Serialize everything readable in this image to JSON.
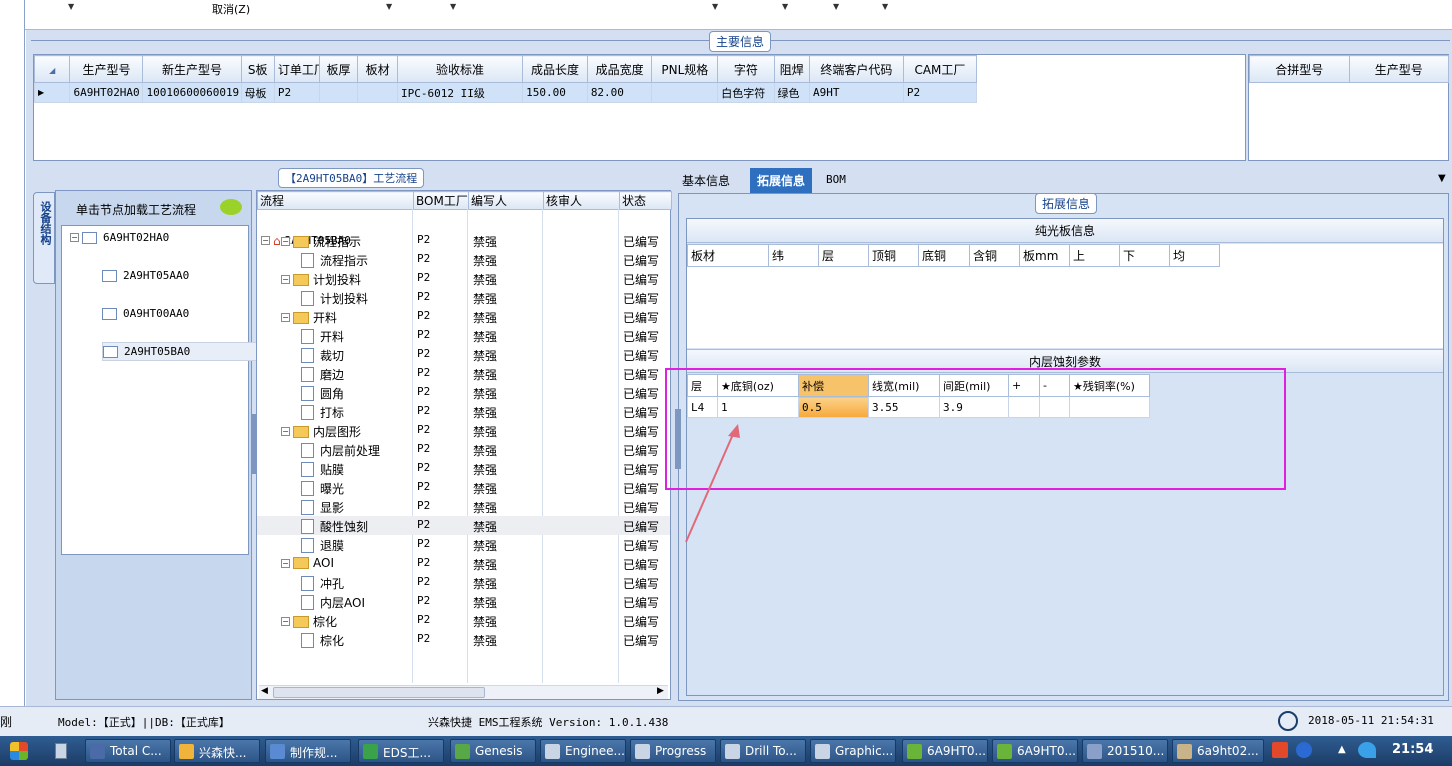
{
  "toolbar": {
    "cancel_label": "取消(Z)"
  },
  "main_info": {
    "title": "主要信息",
    "columns": [
      "生产型号",
      "新生产型号",
      "S板",
      "订单工厂",
      "板厚",
      "板材",
      "验收标准",
      "成品长度",
      "成品宽度",
      "PNL规格",
      "字符",
      "阻焊",
      "终端客户代码",
      "CAM工厂"
    ],
    "row": [
      "6A9HT02HA0",
      "10010600060019",
      "母板",
      "P2",
      "",
      "",
      "IPC-6012 II级",
      "150.00",
      "82.00",
      "",
      "白色字符",
      "绿色",
      "A9HT",
      "P2"
    ],
    "side_columns": [
      "合拼型号",
      "生产型号"
    ]
  },
  "left_panel": {
    "side_tab": "设备结构",
    "hint": "单击节点加载工艺流程",
    "tree_root": "6A9HT02HA0",
    "tree_children": [
      "2A9HT05AA0",
      "0A9HT00AA0",
      "2A9HT05BA0"
    ]
  },
  "process": {
    "title": "【2A9HT05BA0】工艺流程",
    "columns": [
      "流程",
      "BOM工厂",
      "编写人",
      "核审人",
      "状态"
    ],
    "root": "2A9HT05BA0",
    "rows": [
      {
        "name": "流程指示",
        "level": 1,
        "folder": true,
        "factory": "P2",
        "writer": "禁强",
        "reviewer": "",
        "status": "已编写"
      },
      {
        "name": "流程指示",
        "level": 2,
        "folder": false,
        "factory": "P2",
        "writer": "禁强",
        "reviewer": "",
        "status": "已编写"
      },
      {
        "name": "计划投料",
        "level": 1,
        "folder": true,
        "factory": "P2",
        "writer": "禁强",
        "reviewer": "",
        "status": "已编写"
      },
      {
        "name": "计划投料",
        "level": 2,
        "folder": false,
        "factory": "P2",
        "writer": "禁强",
        "reviewer": "",
        "status": "已编写"
      },
      {
        "name": "开料",
        "level": 1,
        "folder": true,
        "factory": "P2",
        "writer": "禁强",
        "reviewer": "",
        "status": "已编写"
      },
      {
        "name": "开料",
        "level": 2,
        "folder": false,
        "factory": "P2",
        "writer": "禁强",
        "reviewer": "",
        "status": "已编写"
      },
      {
        "name": "裁切",
        "level": 2,
        "folder": false,
        "factory": "P2",
        "writer": "禁强",
        "reviewer": "",
        "status": "已编写"
      },
      {
        "name": "磨边",
        "level": 2,
        "folder": false,
        "factory": "P2",
        "writer": "禁强",
        "reviewer": "",
        "status": "已编写"
      },
      {
        "name": "圆角",
        "level": 2,
        "folder": false,
        "factory": "P2",
        "writer": "禁强",
        "reviewer": "",
        "status": "已编写"
      },
      {
        "name": "打标",
        "level": 2,
        "folder": false,
        "factory": "P2",
        "writer": "禁强",
        "reviewer": "",
        "status": "已编写"
      },
      {
        "name": "内层图形",
        "level": 1,
        "folder": true,
        "factory": "P2",
        "writer": "禁强",
        "reviewer": "",
        "status": "已编写"
      },
      {
        "name": "内层前处理",
        "level": 2,
        "folder": false,
        "factory": "P2",
        "writer": "禁强",
        "reviewer": "",
        "status": "已编写"
      },
      {
        "name": "贴膜",
        "level": 2,
        "folder": false,
        "factory": "P2",
        "writer": "禁强",
        "reviewer": "",
        "status": "已编写"
      },
      {
        "name": "曝光",
        "level": 2,
        "folder": false,
        "factory": "P2",
        "writer": "禁强",
        "reviewer": "",
        "status": "已编写"
      },
      {
        "name": "显影",
        "level": 2,
        "folder": false,
        "factory": "P2",
        "writer": "禁强",
        "reviewer": "",
        "status": "已编写"
      },
      {
        "name": "酸性蚀刻",
        "level": 2,
        "folder": false,
        "factory": "P2",
        "writer": "禁强",
        "reviewer": "",
        "status": "已编写",
        "selected": true
      },
      {
        "name": "退膜",
        "level": 2,
        "folder": false,
        "factory": "P2",
        "writer": "禁强",
        "reviewer": "",
        "status": "已编写"
      },
      {
        "name": "AOI",
        "level": 1,
        "folder": true,
        "factory": "P2",
        "writer": "禁强",
        "reviewer": "",
        "status": "已编写"
      },
      {
        "name": "冲孔",
        "level": 2,
        "folder": false,
        "factory": "P2",
        "writer": "禁强",
        "reviewer": "",
        "status": "已编写"
      },
      {
        "name": "内层AOI",
        "level": 2,
        "folder": false,
        "factory": "P2",
        "writer": "禁强",
        "reviewer": "",
        "status": "已编写"
      },
      {
        "name": "棕化",
        "level": 1,
        "folder": true,
        "factory": "P2",
        "writer": "禁强",
        "reviewer": "",
        "status": "已编写"
      },
      {
        "name": "棕化",
        "level": 2,
        "folder": false,
        "factory": "P2",
        "writer": "禁强",
        "reviewer": "",
        "status": "已编写"
      }
    ]
  },
  "right_tabs": [
    "基本信息",
    "拓展信息",
    "BOM"
  ],
  "ext_info": {
    "title": "拓展信息",
    "plain_title": "纯光板信息",
    "plain_columns": [
      "板材",
      "纬",
      "层",
      "顶铜",
      "底铜",
      "含铜",
      "板mm",
      "上",
      "下",
      "均"
    ],
    "inner_title": "内层蚀刻参数",
    "inner_columns": [
      "层",
      "★底铜(oz)",
      "补偿",
      "线宽(mil)",
      "间距(mil)",
      "+",
      "-",
      "★残铜率(%)"
    ],
    "inner_row": [
      "L4",
      "1",
      "0.5",
      "3.55",
      "3.9",
      "",
      "",
      ""
    ]
  },
  "status": {
    "left": "刚",
    "model": "Model:【正式】||DB:【正式库】",
    "app": "兴森快捷 EMS工程系统 Version: 1.0.1.438",
    "datetime": "2018-05-11 21:54:31"
  },
  "taskbar": {
    "items": [
      "Total C...",
      "兴森快...",
      "制作规...",
      "EDS工...",
      "Genesis",
      "Enginee...",
      "Progress",
      "Drill To...",
      "Graphic...",
      "6A9HT0...",
      "6A9HT0...",
      "201510...",
      "6a9ht02..."
    ],
    "clock": "21:54"
  },
  "colors": {
    "highlight": "#e020e0",
    "arrow": "#e06a7a",
    "selected_tab": "#2e6fc0",
    "accent_cell": "#f7c36a"
  }
}
